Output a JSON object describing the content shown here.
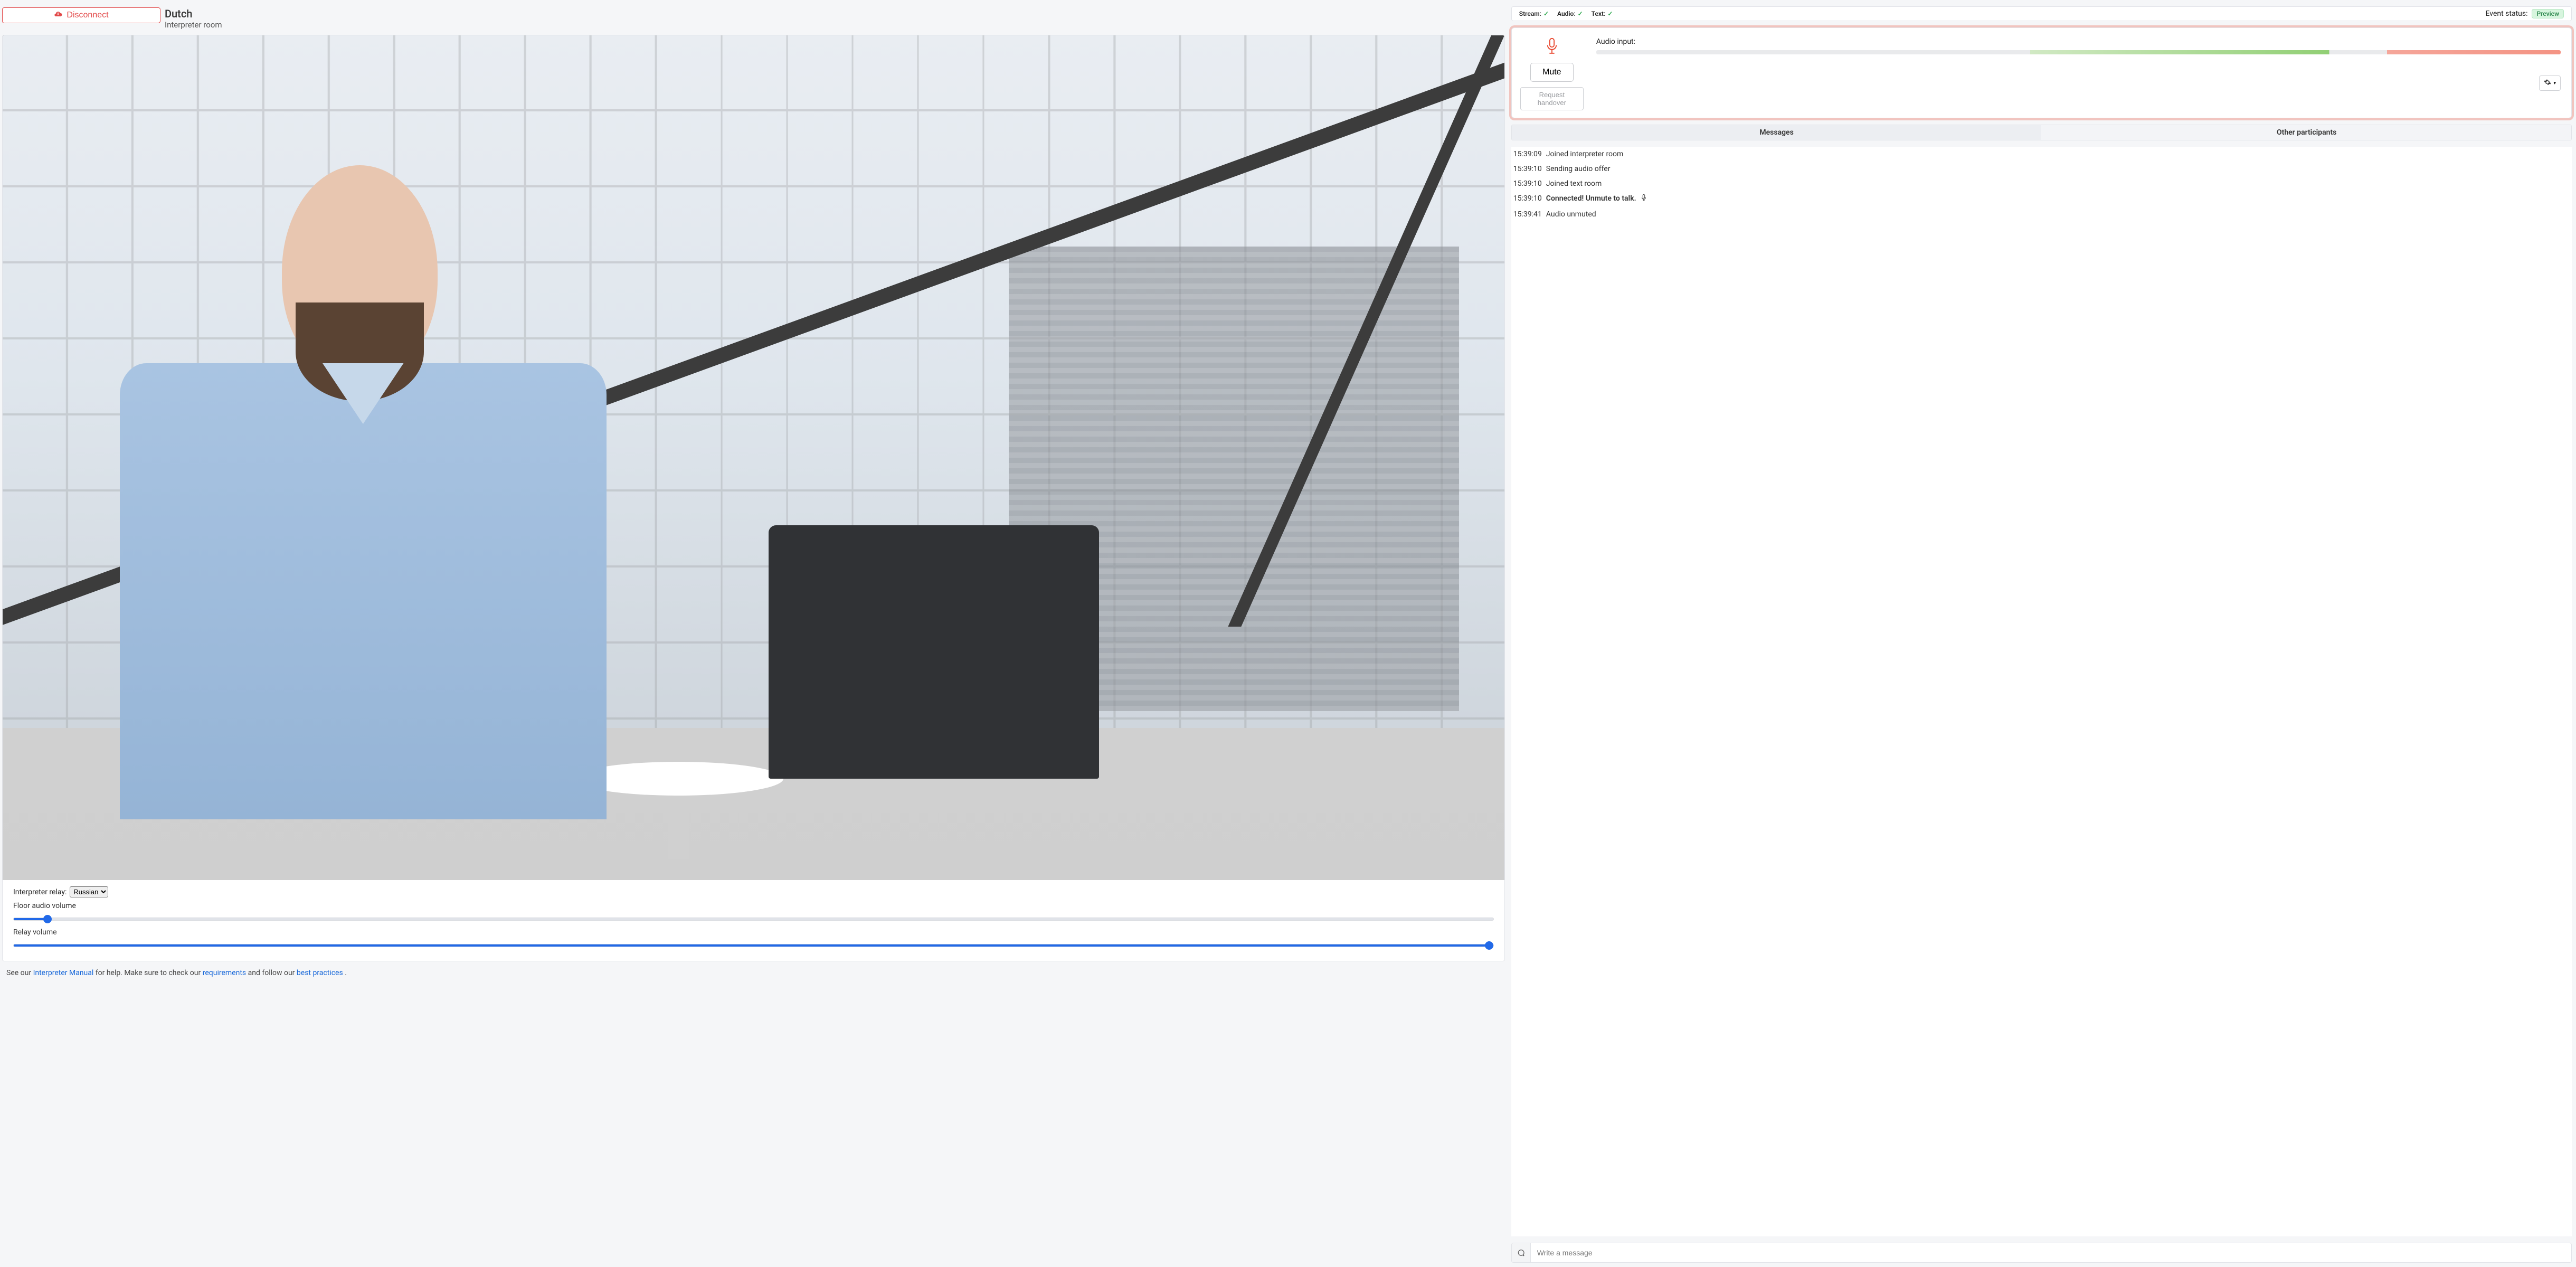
{
  "header": {
    "disconnect_label": "Disconnect",
    "language": "Dutch",
    "subtitle": "Interpreter room"
  },
  "controls": {
    "relay_label": "Interpreter relay:",
    "relay_selected": "Russian",
    "floor_label": "Floor audio volume",
    "relay_volume_label": "Relay volume",
    "floor_value": 2,
    "relay_value": 100
  },
  "help": {
    "pre": "See our ",
    "link1": "Interpreter Manual",
    "mid1": " for help. Make sure to check our ",
    "link2": "requirements",
    "mid2": " and follow our ",
    "link3": "best practices",
    "end": "."
  },
  "status": {
    "stream_label": "Stream:",
    "audio_label": "Audio:",
    "text_label": "Text:",
    "event_status_label": "Event status:",
    "badge": "Preview"
  },
  "audio_panel": {
    "input_label": "Audio input:",
    "mute_label": "Mute",
    "handover_label": "Request handover"
  },
  "tabs": {
    "messages": "Messages",
    "participants": "Other participants"
  },
  "messages": [
    {
      "ts": "15:39:09",
      "text": "Joined interpreter room",
      "bold": false,
      "mic": false
    },
    {
      "ts": "15:39:10",
      "text": "Sending audio offer",
      "bold": false,
      "mic": false
    },
    {
      "ts": "15:39:10",
      "text": "Joined text room",
      "bold": false,
      "mic": false
    },
    {
      "ts": "15:39:10",
      "text": "Connected! Unmute to talk.",
      "bold": true,
      "mic": true
    },
    {
      "ts": "15:39:41",
      "text": "Audio unmuted",
      "bold": false,
      "mic": false
    }
  ],
  "compose": {
    "placeholder": "Write a message"
  }
}
